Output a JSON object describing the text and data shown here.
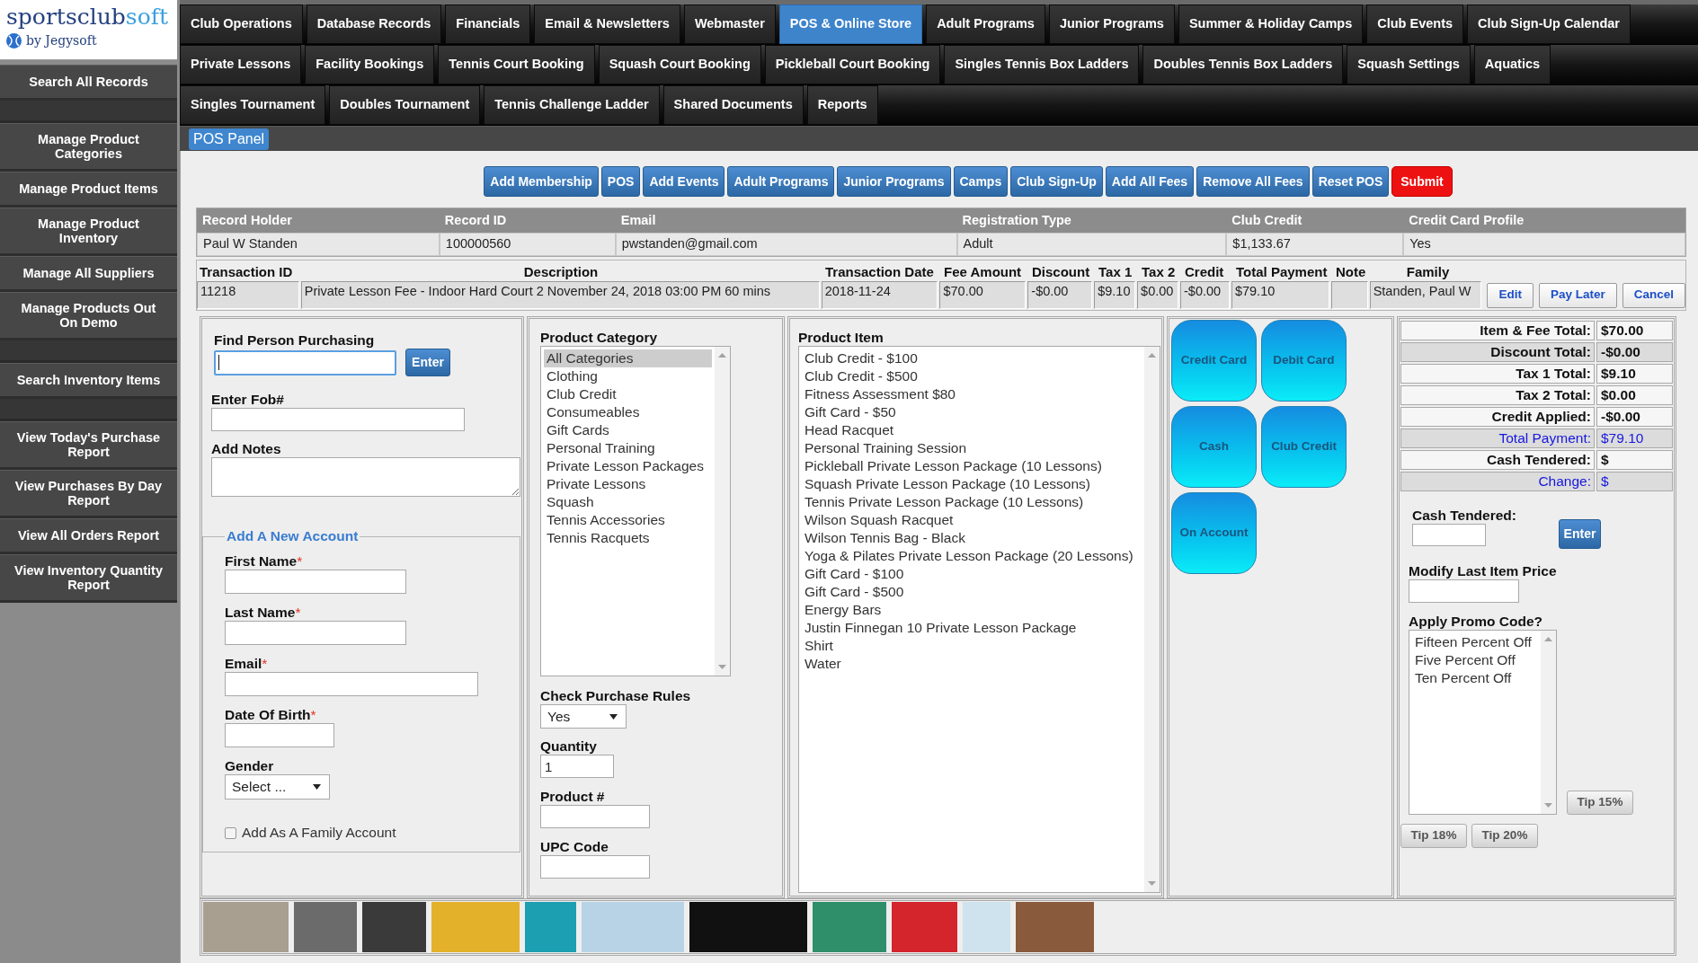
{
  "logo": {
    "wordmark": "sportsclub",
    "wordmark_accent": "soft",
    "byline": "by Jegysoft"
  },
  "sidebar": {
    "sections": [
      {
        "items": [
          {
            "label": "Search All Records"
          }
        ]
      },
      {
        "items": [
          {
            "label": "Manage Product Categories"
          },
          {
            "label": "Manage Product Items"
          },
          {
            "label": "Manage Product Inventory"
          },
          {
            "label": "Manage All Suppliers"
          },
          {
            "label": "Manage Products Out On Demo"
          }
        ]
      },
      {
        "items": [
          {
            "label": "Search Inventory Items"
          }
        ]
      },
      {
        "items": [
          {
            "label": "View Today's Purchase Report"
          },
          {
            "label": "View Purchases By Day Report"
          },
          {
            "label": "View All Orders Report"
          },
          {
            "label": "View Inventory Quantity Report"
          }
        ]
      }
    ]
  },
  "main_nav": {
    "rows": [
      {
        "tabs": [
          {
            "label": "Club Operations",
            "selected": false
          },
          {
            "label": "Database Records",
            "selected": false
          },
          {
            "label": "Financials",
            "selected": false
          },
          {
            "label": "Email & Newsletters",
            "selected": false
          },
          {
            "label": "Webmaster",
            "selected": false
          },
          {
            "label": "POS & Online Store",
            "selected": true
          },
          {
            "label": "Adult Programs",
            "selected": false
          },
          {
            "label": "Junior Programs",
            "selected": false
          },
          {
            "label": "Summer & Holiday Camps",
            "selected": false
          },
          {
            "label": "Club Events",
            "selected": false
          },
          {
            "label": "Club Sign-Up Calendar",
            "selected": false
          }
        ]
      },
      {
        "tabs": [
          {
            "label": "Private Lessons",
            "selected": false
          },
          {
            "label": "Facility Bookings",
            "selected": false
          },
          {
            "label": "Tennis Court Booking",
            "selected": false
          },
          {
            "label": "Squash Court Booking",
            "selected": false
          },
          {
            "label": "Pickleball Court Booking",
            "selected": false
          },
          {
            "label": "Singles Tennis Box Ladders",
            "selected": false
          },
          {
            "label": "Doubles Tennis Box Ladders",
            "selected": false
          },
          {
            "label": "Squash Settings",
            "selected": false
          },
          {
            "label": "Aquatics",
            "selected": false
          }
        ]
      },
      {
        "tabs": [
          {
            "label": "Singles Tournament",
            "selected": false
          },
          {
            "label": "Doubles Tournament",
            "selected": false
          },
          {
            "label": "Tennis Challenge Ladder",
            "selected": false
          },
          {
            "label": "Shared Documents",
            "selected": false
          },
          {
            "label": "Reports",
            "selected": false
          }
        ]
      }
    ]
  },
  "sub_tabs": [
    {
      "label": "POS Panel",
      "selected": true
    }
  ],
  "action_buttons": [
    {
      "label": "Add Membership",
      "kind": "primary"
    },
    {
      "label": "POS",
      "kind": "primary"
    },
    {
      "label": "Add Events",
      "kind": "primary"
    },
    {
      "label": "Adult Programs",
      "kind": "primary"
    },
    {
      "label": "Junior Programs",
      "kind": "primary"
    },
    {
      "label": "Camps",
      "kind": "primary"
    },
    {
      "label": "Club Sign-Up",
      "kind": "primary"
    },
    {
      "label": "Add All Fees",
      "kind": "primary"
    },
    {
      "label": "Remove All Fees",
      "kind": "primary"
    },
    {
      "label": "Reset POS",
      "kind": "primary"
    },
    {
      "label": "Submit",
      "kind": "danger"
    }
  ],
  "record_table": {
    "columns": [
      "Record Holder",
      "Record ID",
      "Email",
      "Registration Type",
      "Club Credit",
      "Credit Card Profile"
    ],
    "rows": [
      [
        "Paul W Standen",
        "100000560",
        "pwstanden@gmail.com",
        "Adult",
        "$1,133.67",
        "Yes"
      ]
    ]
  },
  "transaction_table": {
    "columns": [
      {
        "label": "Transaction ID",
        "cells": [
          "11218"
        ]
      },
      {
        "label": "Description",
        "cells": [
          "Private Lesson Fee - Indoor Hard Court 2 November 24, 2018 03:00 PM 60 mins"
        ]
      },
      {
        "label": "Transaction Date",
        "cells": [
          "2018-11-24"
        ]
      },
      {
        "label": "Fee Amount",
        "cells": [
          "$70.00"
        ]
      },
      {
        "label": "Discount",
        "cells": [
          "-$0.00"
        ]
      },
      {
        "label": "Tax 1",
        "cells": [
          "$9.10"
        ]
      },
      {
        "label": "Tax 2",
        "cells": [
          "$0.00"
        ]
      },
      {
        "label": "Credit",
        "cells": [
          "-$0.00"
        ]
      },
      {
        "label": "Total Payment",
        "cells": [
          "$79.10"
        ]
      },
      {
        "label": "Note"
      },
      {
        "label": "Family",
        "cells": [
          "Standen, Paul W"
        ]
      }
    ],
    "row_actions": [
      {
        "buttons": [
          "Edit",
          "Pay Later",
          "Cancel"
        ]
      }
    ]
  },
  "find_person": {
    "label": "Find Person Purchasing",
    "focused": true,
    "button": "Enter"
  },
  "fob": {
    "label": "Enter Fob#"
  },
  "notes": {
    "label": "Add Notes"
  },
  "new_account": {
    "legend": "Add A New Account",
    "fields": [
      {
        "label": "First Name",
        "required_mark": "*",
        "kind": "name"
      },
      {
        "label": "Last Name",
        "required_mark": "*",
        "kind": "name"
      },
      {
        "label": "Email",
        "required_mark": "*",
        "kind": "email"
      },
      {
        "label": "Date Of Birth",
        "required_mark": "*",
        "kind": "date"
      },
      {
        "label": "Gender",
        "kind": "select",
        "value": "Select ..."
      }
    ],
    "family_checkbox": {
      "label": "Add As A Family Account",
      "checked": false
    }
  },
  "product_category": {
    "label": "Product Category",
    "options": [
      {
        "label": "All Categories",
        "selected": true
      },
      {
        "label": "Clothing",
        "selected": false
      },
      {
        "label": "Club Credit",
        "selected": false
      },
      {
        "label": "Consumeables",
        "selected": false
      },
      {
        "label": "Gift Cards",
        "selected": false
      },
      {
        "label": "Personal Training",
        "selected": false
      },
      {
        "label": "Private Lesson Packages",
        "selected": false
      },
      {
        "label": "Private Lessons",
        "selected": false
      },
      {
        "label": "Squash",
        "selected": false
      },
      {
        "label": "Tennis Accessories",
        "selected": false
      },
      {
        "label": "Tennis Racquets",
        "selected": false
      }
    ]
  },
  "purchase_rules": {
    "label": "Check Purchase Rules",
    "value": "Yes"
  },
  "quantity": {
    "label": "Quantity",
    "value": "1"
  },
  "product_number": {
    "label": "Product #"
  },
  "upc_code": {
    "label": "UPC Code"
  },
  "product_item": {
    "label": "Product Item",
    "options": [
      {
        "label": "Club Credit - $100",
        "selected": false
      },
      {
        "label": "Club Credit - $500",
        "selected": false
      },
      {
        "label": "Fitness Assessment $80",
        "selected": false
      },
      {
        "label": "Gift Card - $50",
        "selected": false
      },
      {
        "label": "Head Racquet",
        "selected": false
      },
      {
        "label": "Personal Training Session",
        "selected": false
      },
      {
        "label": "Pickleball Private Lesson Package (10 Lessons)",
        "selected": false
      },
      {
        "label": "Squash Private Lesson Package (10 Lessons)",
        "selected": false
      },
      {
        "label": "Tennis Private Lesson Package (10 Lessons)",
        "selected": false
      },
      {
        "label": "Wilson Squash Racquet",
        "selected": false
      },
      {
        "label": "Wilson Tennis Bag - Black",
        "selected": false
      },
      {
        "label": "Yoga & Pilates Private Lesson Package (20 Lessons)",
        "selected": false
      },
      {
        "label": "Gift Card - $100",
        "selected": false
      },
      {
        "label": "Gift Card - $500",
        "selected": false
      },
      {
        "label": "Energy Bars",
        "selected": false
      },
      {
        "label": "Justin Finnegan 10 Private Lesson Package",
        "selected": false
      },
      {
        "label": "Shirt",
        "selected": false
      },
      {
        "label": "Water",
        "selected": false
      }
    ]
  },
  "payment_methods": [
    {
      "label": "Credit Card"
    },
    {
      "label": "Debit Card"
    },
    {
      "label": "Cash"
    },
    {
      "label": "Club Credit"
    },
    {
      "label": "On Account"
    }
  ],
  "totals": [
    {
      "label": "Item & Fee Total:",
      "value": "$70.00",
      "shaded": false,
      "highlighted": false
    },
    {
      "label": "Discount Total:",
      "value": "-$0.00",
      "shaded": true,
      "highlighted": false
    },
    {
      "label": "Tax 1 Total:",
      "value": "$9.10",
      "shaded": false,
      "highlighted": false
    },
    {
      "label": "Tax 2 Total:",
      "value": "$0.00",
      "shaded": false,
      "highlighted": false
    },
    {
      "label": "Credit Applied:",
      "value": "-$0.00",
      "shaded": false,
      "highlighted": false
    },
    {
      "label": "Total Payment:",
      "value": "$79.10",
      "shaded": true,
      "highlighted": true
    },
    {
      "label": "Cash Tendered:",
      "value": "$",
      "shaded": false,
      "highlighted": false
    },
    {
      "label": "Change:",
      "value": "$",
      "shaded": true,
      "highlighted": true
    }
  ],
  "cash_tendered": {
    "label": "Cash Tendered:",
    "button": "Enter"
  },
  "modify_price": {
    "label": "Modify Last Item Price"
  },
  "promo_code": {
    "label": "Apply Promo Code?",
    "options": [
      {
        "label": "Fifteen Percent Off",
        "selected": false
      },
      {
        "label": "Five Percent Off",
        "selected": false
      },
      {
        "label": "Ten Percent Off",
        "selected": false
      }
    ]
  },
  "tips": [
    {
      "label": "Tip 15%"
    },
    {
      "label": "Tip 18%"
    },
    {
      "label": "Tip 20%"
    }
  ]
}
